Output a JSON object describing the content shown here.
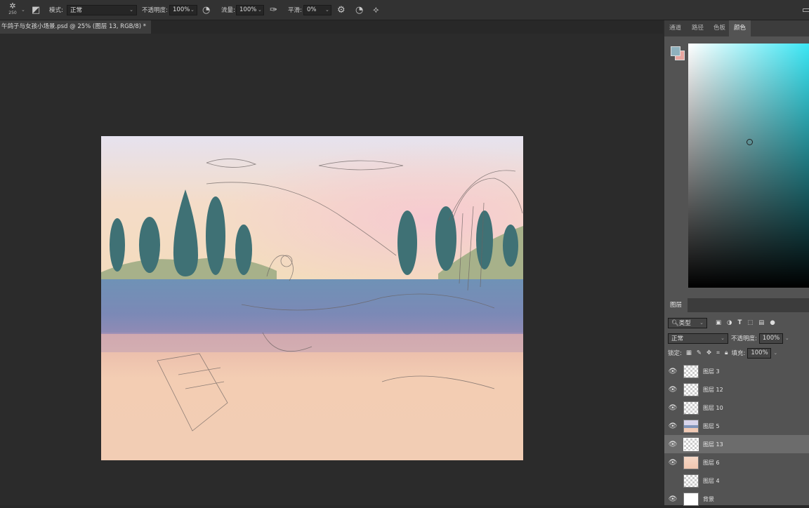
{
  "options_bar": {
    "brush_size": "250",
    "mode_label": "模式:",
    "mode_value": "正常",
    "opacity_label": "不透明度:",
    "opacity_value": "100%",
    "flow_label": "流量:",
    "flow_value": "100%",
    "smoothing_label": "平滑:",
    "smoothing_value": "0%"
  },
  "document_tab": {
    "title": "午鸽子与女孩小场景.psd @ 25% (图层 13, RGB/8) *"
  },
  "color_panel": {
    "tabs": [
      "通道",
      "路径",
      "色板",
      "颜色"
    ],
    "active_tab": "颜色",
    "foreground_color": "#8fb1bd",
    "background_color": "#e8a6a0",
    "hue_color": "#38e6f4"
  },
  "layers_panel": {
    "title": "图层",
    "filter_label": "类型",
    "blend_mode": "正常",
    "opacity_label": "不透明度:",
    "opacity_value": "100%",
    "lock_label": "锁定:",
    "fill_label": "填充:",
    "fill_value": "100%",
    "layers": [
      {
        "name": "图层 3",
        "visible": true,
        "selected": false
      },
      {
        "name": "图层 12",
        "visible": true,
        "selected": false
      },
      {
        "name": "图层 10",
        "visible": true,
        "selected": false
      },
      {
        "name": "图层 5",
        "visible": true,
        "selected": false
      },
      {
        "name": "图层 13",
        "visible": true,
        "selected": true
      },
      {
        "name": "图层 6",
        "visible": true,
        "selected": false
      },
      {
        "name": "图层 4",
        "visible": false,
        "selected": false
      },
      {
        "name": "背景",
        "visible": true,
        "selected": false
      }
    ]
  }
}
